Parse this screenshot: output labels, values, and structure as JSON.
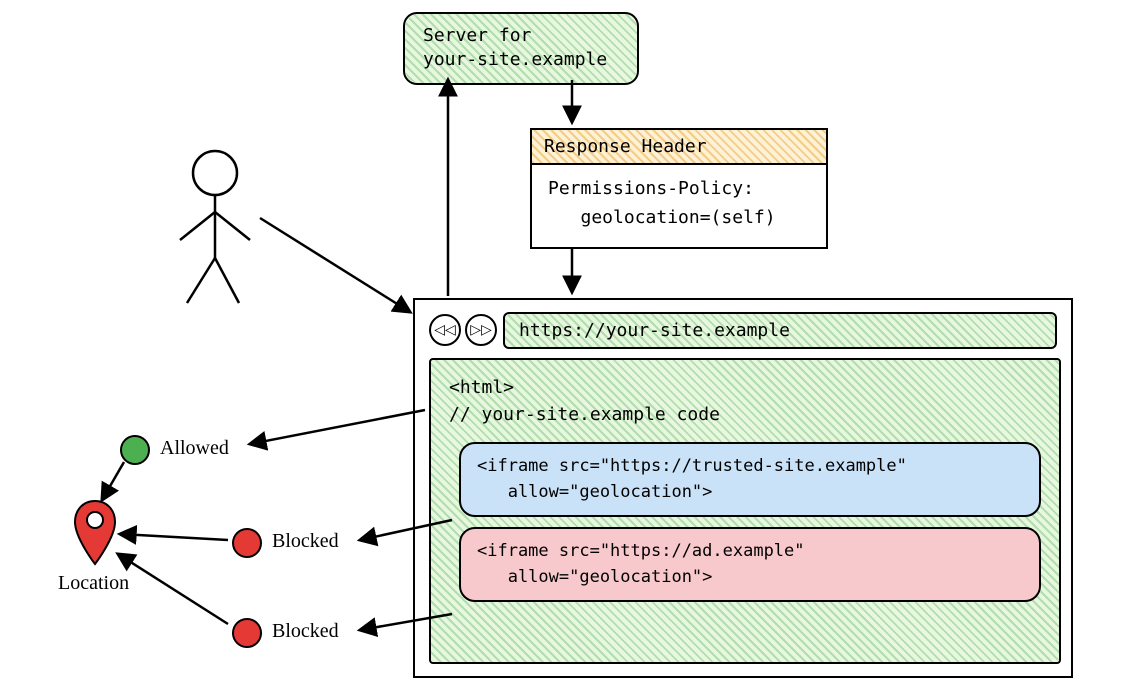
{
  "server": {
    "line1": "Server for",
    "line2": "your-site.example"
  },
  "response": {
    "title": "Response Header",
    "body": "Permissions-Policy:\n   geolocation=(self)"
  },
  "browser": {
    "back_glyph": "◁◁",
    "fwd_glyph": "▷▷",
    "url": "https://your-site.example"
  },
  "page": {
    "line1": "<html>",
    "line2": "// your-site.example code"
  },
  "iframe_trusted": "<iframe src=\"https://trusted-site.example\"\n   allow=\"geolocation\">",
  "iframe_ad": "<iframe src=\"https://ad.example\"\n   allow=\"geolocation\">",
  "status": {
    "allowed": "Allowed",
    "blocked1": "Blocked",
    "blocked2": "Blocked"
  },
  "location_label": "Location"
}
